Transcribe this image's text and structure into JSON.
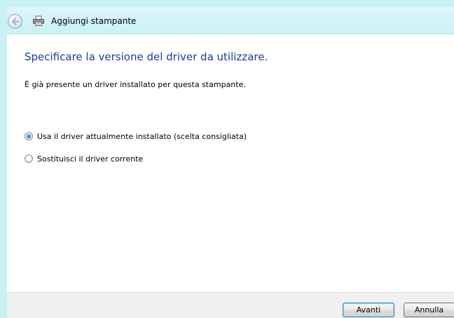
{
  "window": {
    "title": "Aggiungi stampante"
  },
  "content": {
    "heading": "Specificare la versione del driver da utilizzare.",
    "description": "È già presente un driver installato per questa stampante.",
    "options": [
      {
        "label": "Usa il driver attualmente installato (scelta consigliata)",
        "selected": true
      },
      {
        "label": "Sostituisci il driver corrente",
        "selected": false
      }
    ]
  },
  "footer": {
    "next_label": "Avanti",
    "cancel_label": "Annulla"
  },
  "colors": {
    "outer_background": "#c9f1f4",
    "heading": "#1e3e96",
    "footer_background": "#f0f0f0"
  },
  "icons": {
    "back": "back-arrow-icon",
    "printer": "printer-icon"
  }
}
